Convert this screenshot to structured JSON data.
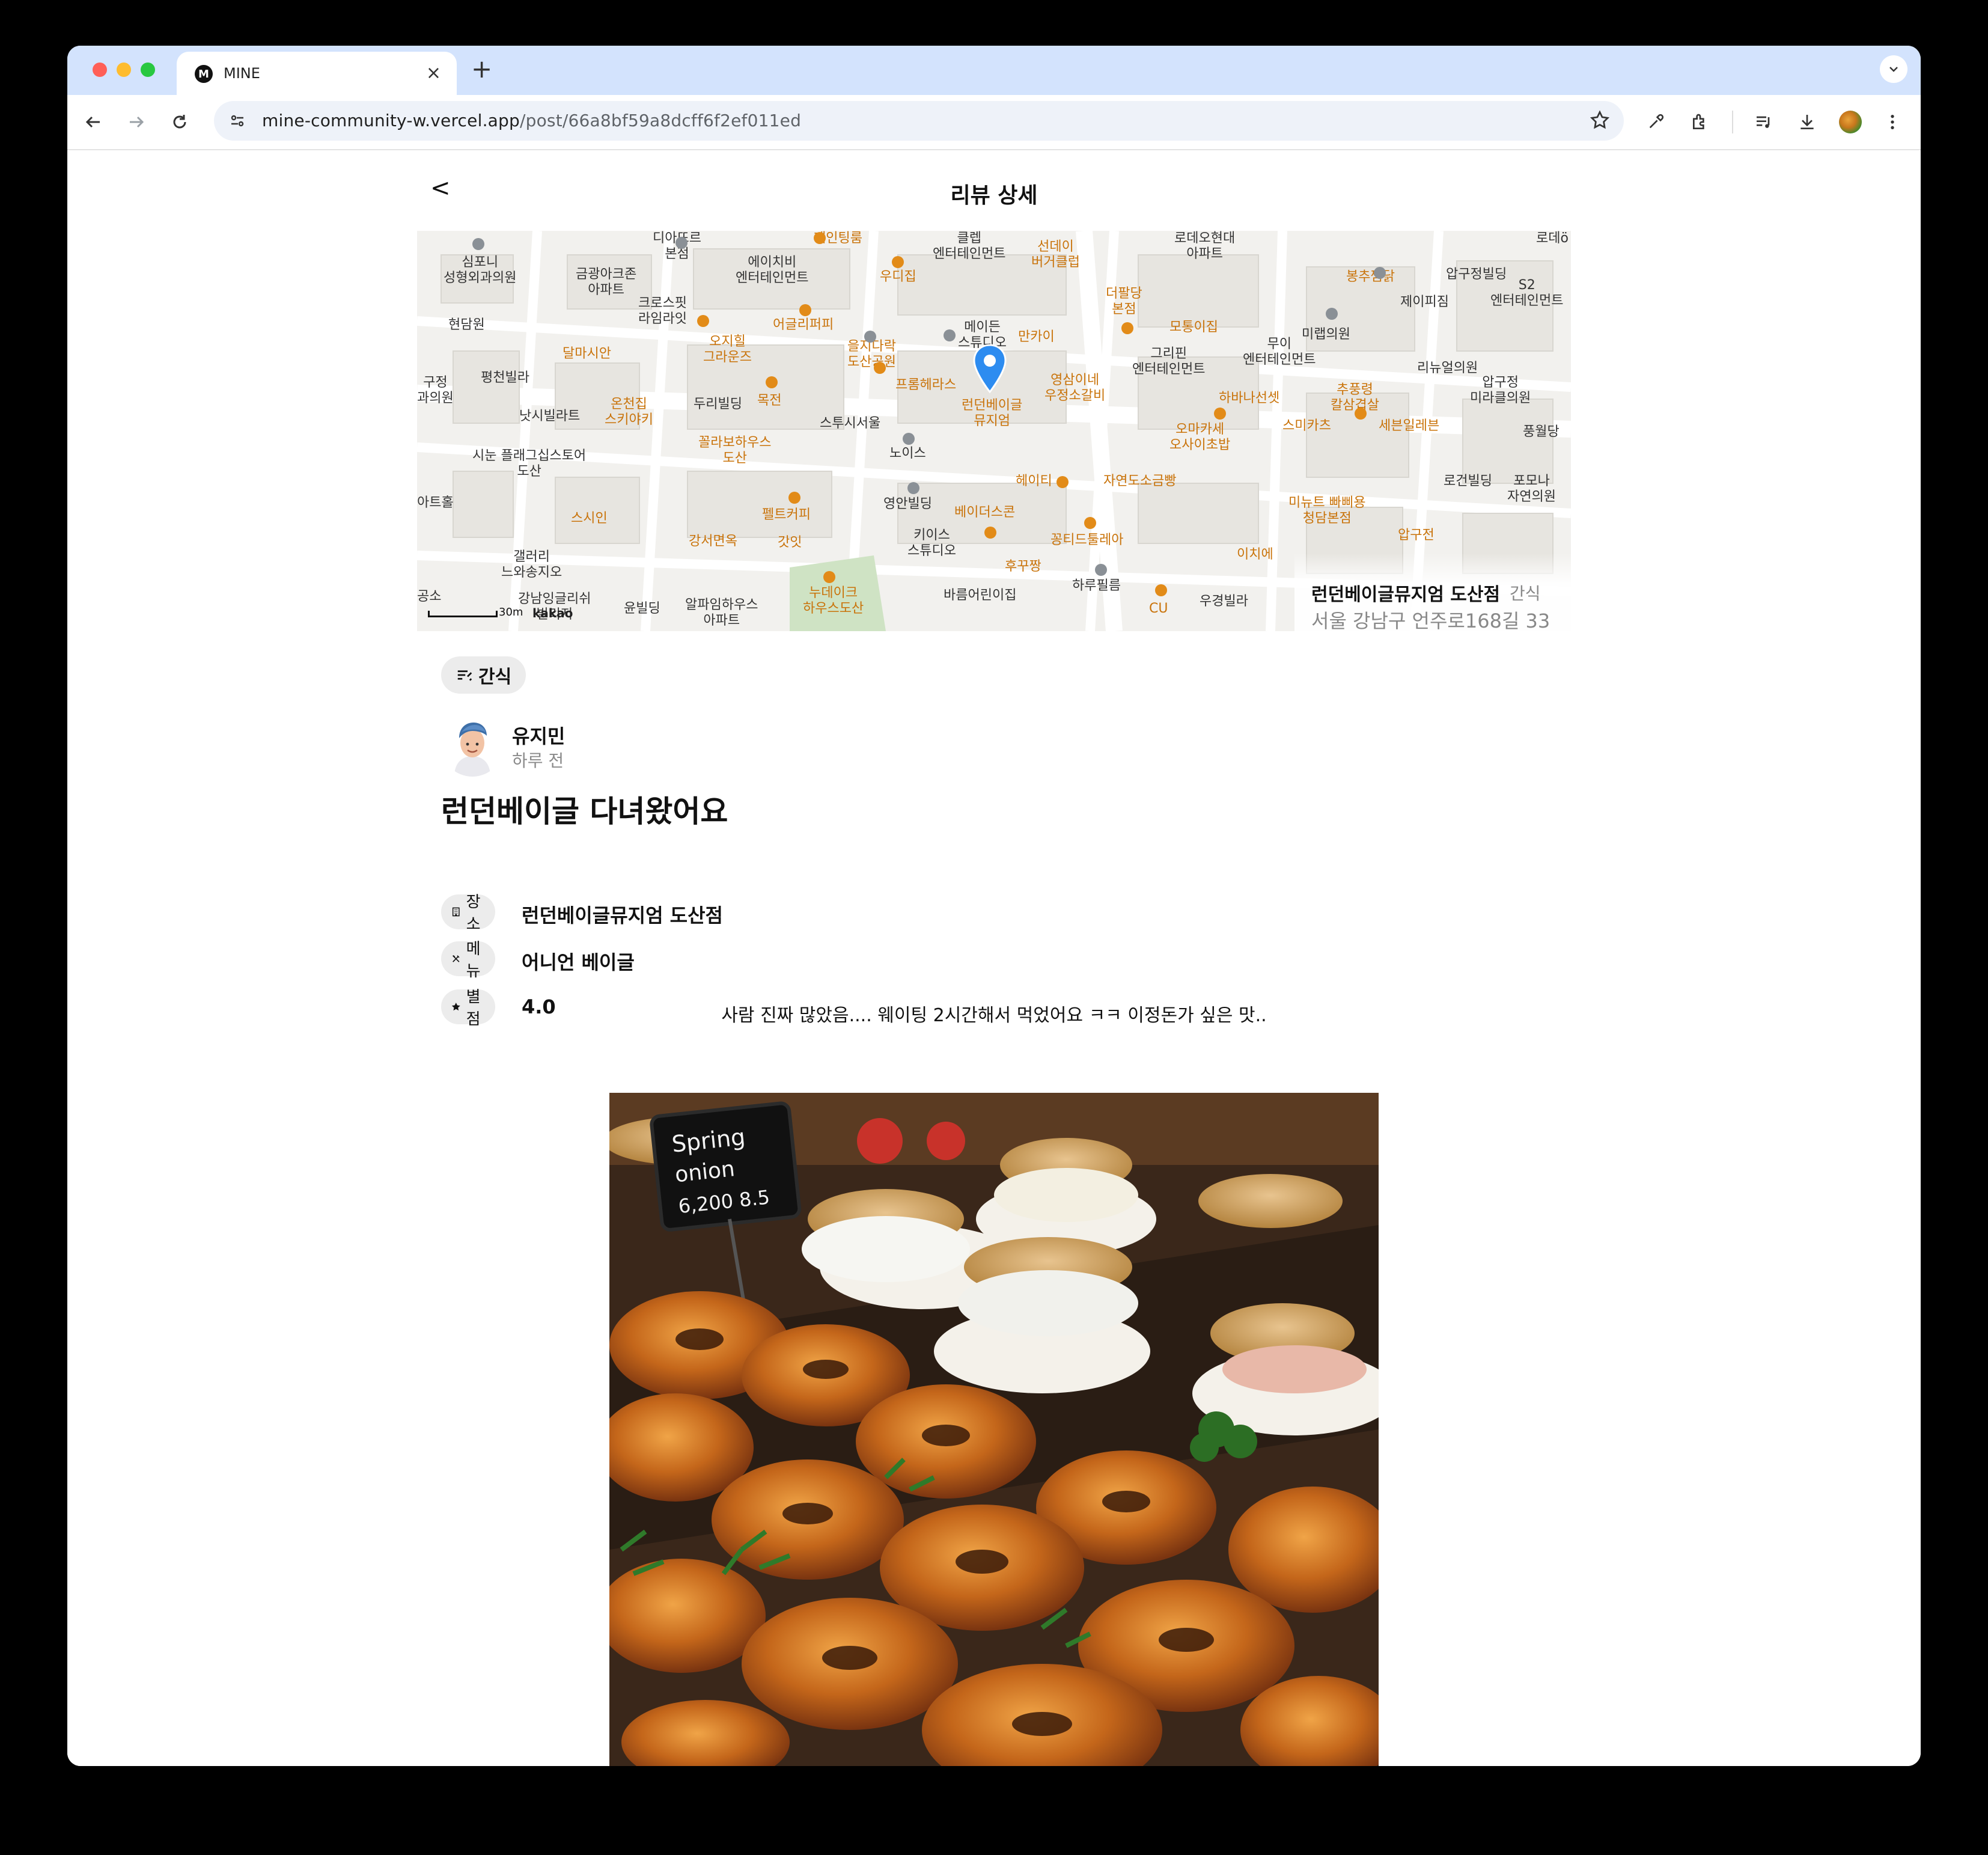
{
  "browser": {
    "tab_title": "MINE",
    "tab_favicon_letter": "M",
    "url_host": "mine-community-w.vercel.app",
    "url_path": "/post/66a8bf59a8dcff6f2ef011ed"
  },
  "header": {
    "back_label": "<",
    "title": "리뷰 상세"
  },
  "map": {
    "place_name": "런던베이글뮤지엄 도산점",
    "place_category": "간식",
    "address": "서울 강남구 언주로168길 33",
    "scale": "30m",
    "provider": "kakao",
    "labels": {
      "l1": "디아뜨르\n본점",
      "l2": "페인팅룸",
      "l3": "클렙\n엔터테인먼트",
      "l4": "선데이\n버거클럽",
      "l5": "로데오현대\n아파트",
      "l6": "로데ö",
      "l7": "심포니\n성형외과의원",
      "l8": "금광아크존\n아파트",
      "l9": "에이치비\n엔터테인먼트",
      "l10": "우디집",
      "l11": "봉추찜닭",
      "l12": "압구정빌딩",
      "l13": "S2\n엔터테인먼트",
      "l14": "제이피짐",
      "l15": "현담원",
      "l16": "크로스핏\n라임라잇",
      "l17": "어글리퍼피",
      "l18": "더팔당\n본점",
      "l19": "모통이집",
      "l20": "메이든\n스튜디오",
      "l21": "만카이",
      "l22": "달마시안",
      "l23": "오지힐\n그라운즈",
      "l24": "을지다락\n도산공원",
      "l25": "그리핀\n엔터테인먼트",
      "l26": "무이\n엔터테인먼트",
      "l27": "미랩의원",
      "l28": "평천빌라",
      "l29": "영삼이네\n우정소갈비",
      "l30": "프롬헤라스",
      "l31": "리뉴얼의원",
      "l32": "압구정\n미라클의원",
      "l33": "온천집\n스키야키",
      "l34": "두리빌딩",
      "l35": "목전",
      "l36": "런던베이글\n뮤지엄",
      "l37": "하바나선셋",
      "l38": "추풍령\n칼삼겹살",
      "l39": "낫시빌라트",
      "l40": "스투시서울",
      "l41": "오마카세\n오사이초밥",
      "l42": "스미카츠",
      "l43": "세븐일레븐",
      "l44": "풍월당",
      "l45": "시눈 플래그십스토어\n도산",
      "l46": "꼴라보하우스\n도산",
      "l47": "노이스",
      "l48": "헤이티",
      "l49": "자연도소금빵",
      "l50": "로건빌딩",
      "l51": "포모나\n자연의원",
      "l52": "스시인",
      "l53": "펠트커피",
      "l54": "영안빌딩",
      "l55": "베이더스콘",
      "l56": "미뉴트 빠삐용\n청담본점",
      "l57": "압구전",
      "l58": "강서면옥",
      "l59": "갓잇",
      "l60": "키이스\n스튜디오",
      "l61": "꽁티드툴레아",
      "l62": "이치에",
      "l63": "갤러리\n느와송지오",
      "l64": "후꾸짱",
      "l65": "하루필름",
      "l66": "강남잉글리쉬\n빌리지",
      "l67": "윤빌딩",
      "l68": "알파임하우스\n아파트",
      "l69": "누데이크\n하우스도산",
      "l70": "바름어린이집",
      "l71": "CU",
      "l72": "우경빌라",
      "l73": "구정\n과의원",
      "l74": "아트홀",
      "l75": "공소"
    }
  },
  "post": {
    "category": "간식",
    "author": "유지민",
    "time": "하루 전",
    "title": "런던베이글 다녀왔어요",
    "place_label": "장소",
    "place_value": "런던베이글뮤지엄 도산점",
    "menu_label": "메뉴",
    "menu_value": "어니언 베이글",
    "rating_label": "별점",
    "rating_value": "4.0",
    "body": "사람 진짜 많았음.... 웨이팅 2시간해서 먹었어요 ㅋㅋ 이정돈가 싶은 맛..",
    "photo_sign": "Spring\nonion\n6,200 8.5"
  },
  "colors": {
    "tab_strip": "#d3e3fd",
    "chip_bg": "#ececec",
    "map_orange": "#c9730a",
    "marker_blue": "#2d8cf0"
  }
}
